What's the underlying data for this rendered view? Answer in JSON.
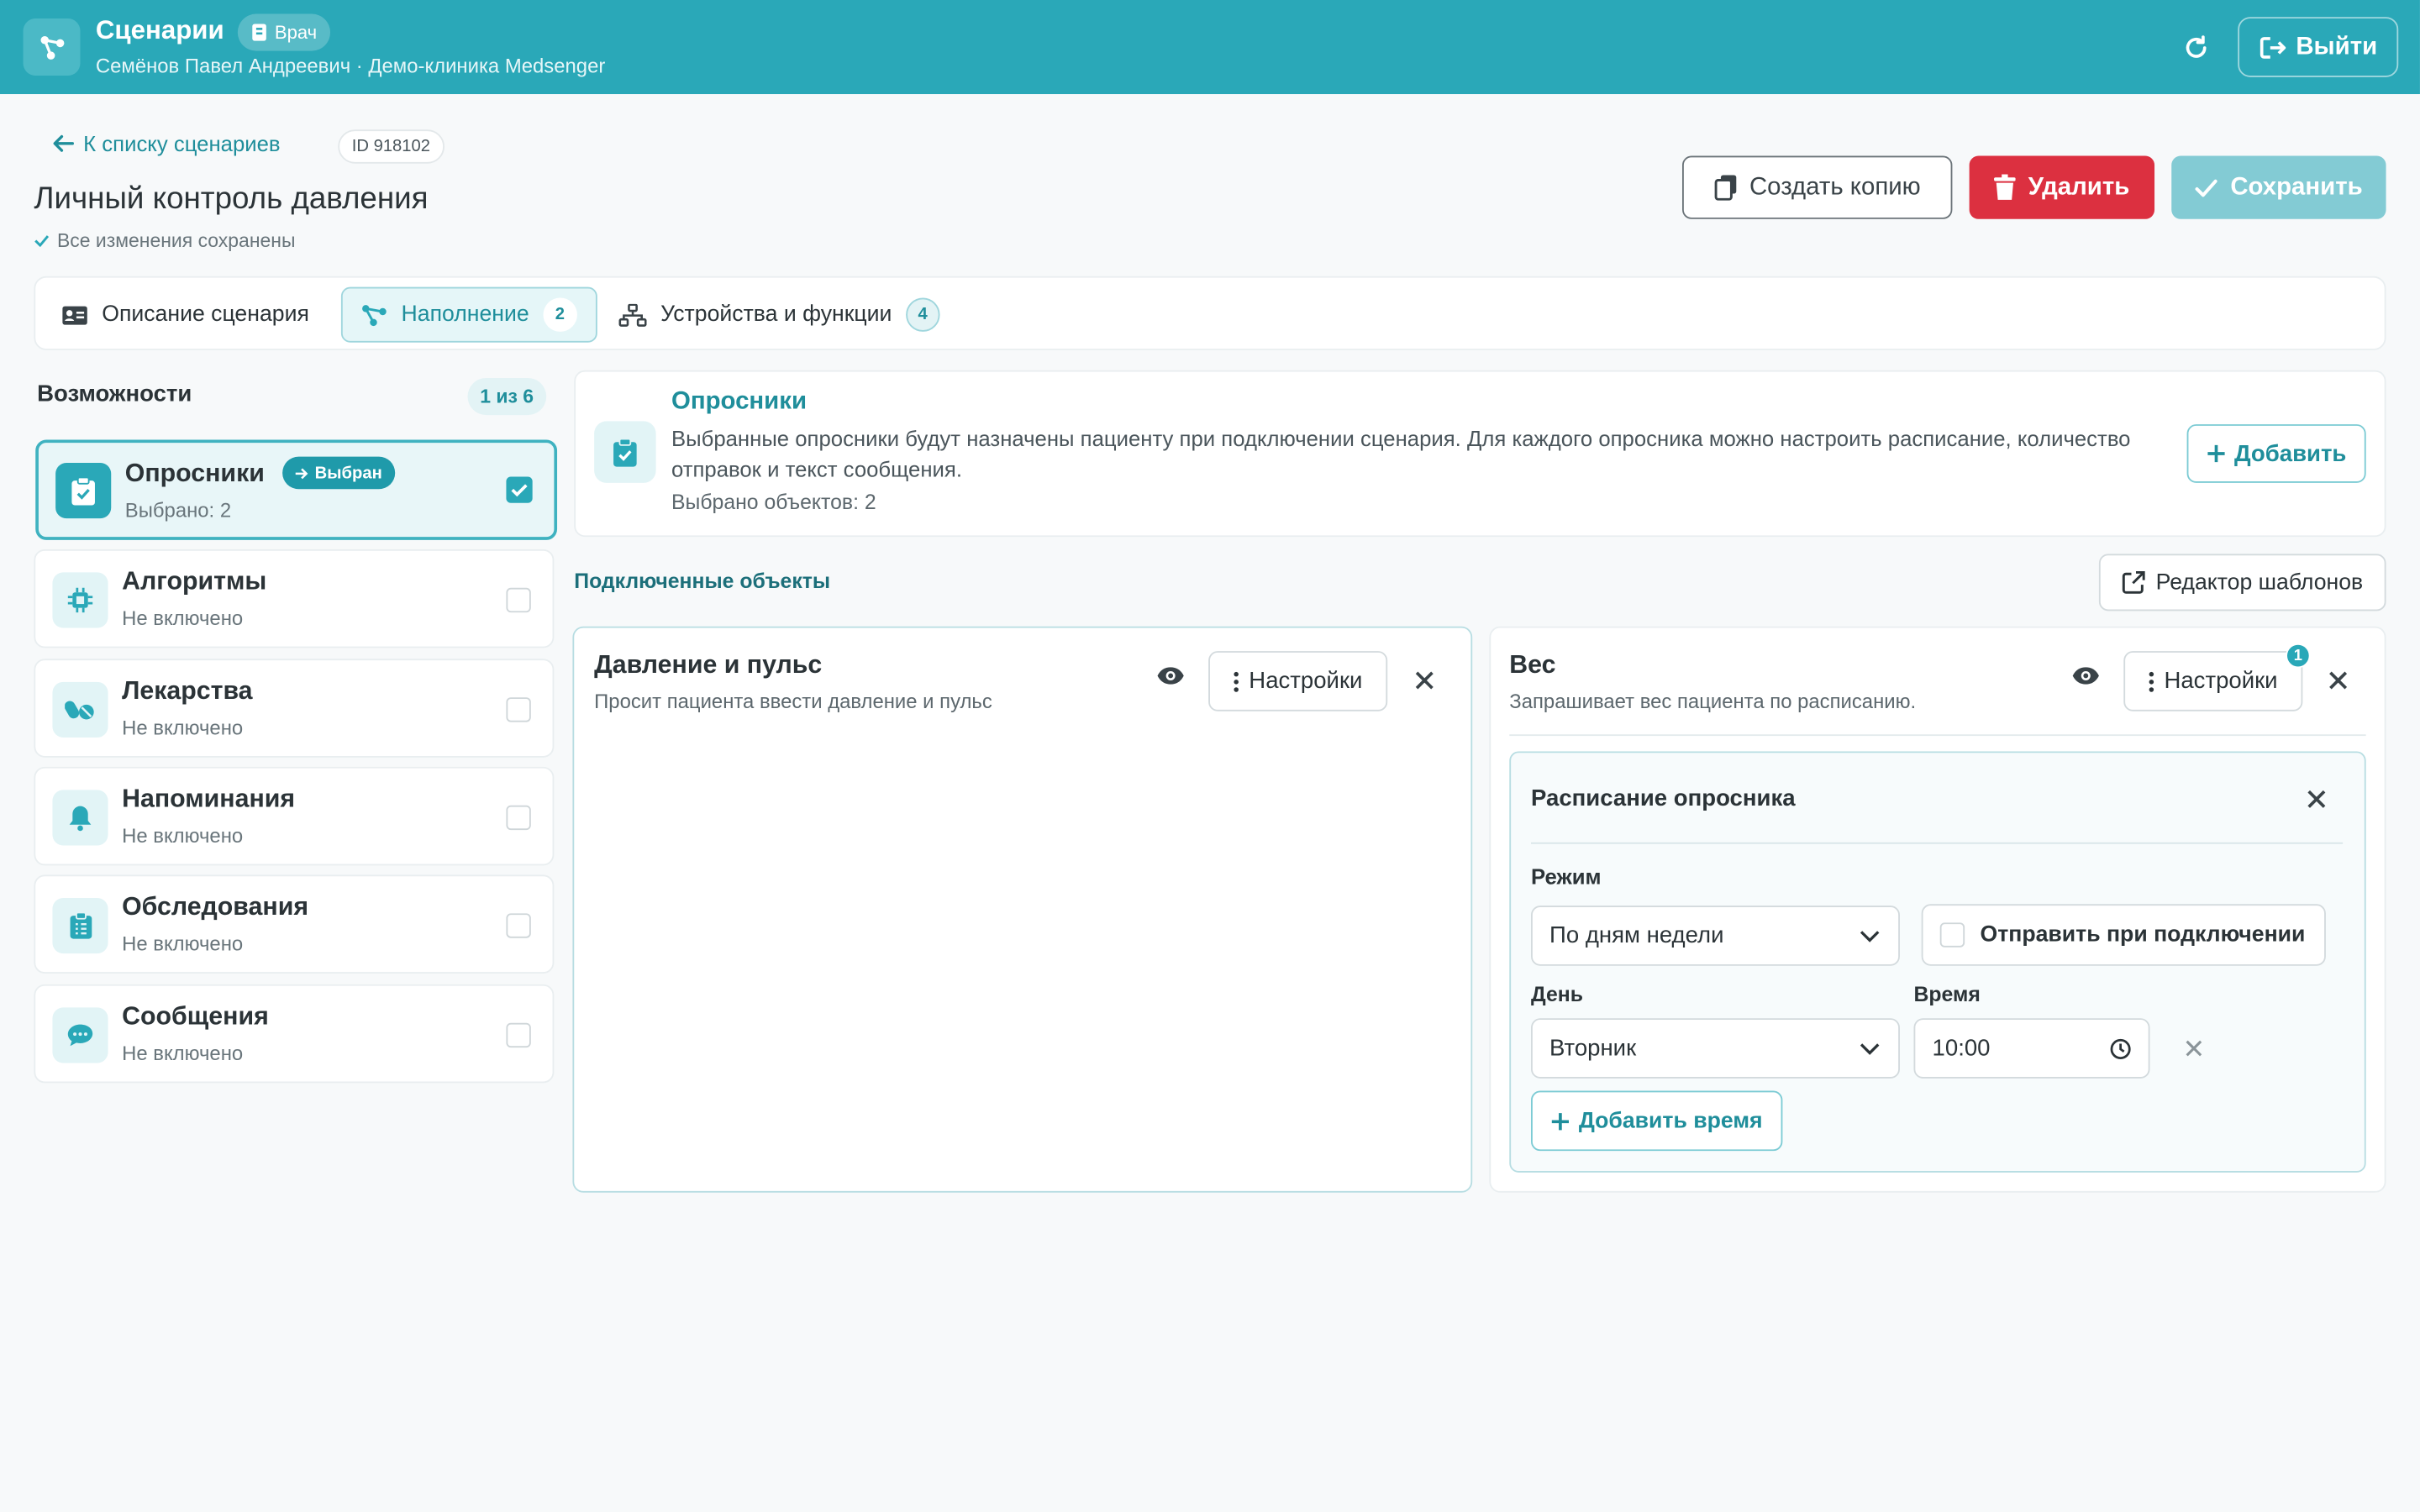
{
  "header": {
    "title": "Сценарии",
    "role": "Врач",
    "subtitle": "Семёнов Павел Андреевич · Демо-клиника Medsenger",
    "logout": "Выйти"
  },
  "page": {
    "back": "К списку сценариев",
    "id": "ID 918102",
    "title": "Личный контроль давления",
    "saved": "Все изменения сохранены",
    "actions": {
      "copy": "Создать копию",
      "delete": "Удалить",
      "save": "Сохранить"
    }
  },
  "tabs": [
    {
      "label": "Описание сценария",
      "count": ""
    },
    {
      "label": "Наполнение",
      "count": "2"
    },
    {
      "label": "Устройства и функции",
      "count": "4"
    }
  ],
  "capabilities": {
    "title": "Возможности",
    "counter": "1 из 6",
    "selected_badge": "Выбран",
    "items": [
      {
        "name": "Опросники",
        "status": "Выбрано: 2",
        "selected": true,
        "icon": "clipboard-check-icon"
      },
      {
        "name": "Алгоритмы",
        "status": "Не включено",
        "selected": false,
        "icon": "chip-icon"
      },
      {
        "name": "Лекарства",
        "status": "Не включено",
        "selected": false,
        "icon": "pills-icon"
      },
      {
        "name": "Напоминания",
        "status": "Не включено",
        "selected": false,
        "icon": "bell-icon"
      },
      {
        "name": "Обследования",
        "status": "Не включено",
        "selected": false,
        "icon": "clipboard-list-icon"
      },
      {
        "name": "Сообщения",
        "status": "Не включено",
        "selected": false,
        "icon": "chat-icon"
      }
    ]
  },
  "info": {
    "title": "Опросники",
    "description": "Выбранные опросники будут назначены пациенту при подключении сценария. Для каждого опросника можно настроить расписание, количество отправок и текст сообщения.",
    "count": "Выбрано объектов: 2",
    "add": "Добавить"
  },
  "connected": {
    "title": "Подключенные объекты",
    "editor": "Редактор шаблонов",
    "cards": [
      {
        "title": "Давление и пульс",
        "desc": "Просит пациента ввести давление и пульс",
        "settings": "Настройки"
      },
      {
        "title": "Вес",
        "desc": "Запрашивает вес пациента по расписанию.",
        "settings": "Настройки",
        "badge": "1"
      }
    ]
  },
  "schedule": {
    "title": "Расписание опросника",
    "mode_label": "Режим",
    "mode_value": "По дням недели",
    "send_on_connect": "Отправить при подключении",
    "day_label": "День",
    "day_value": "Вторник",
    "time_label": "Время",
    "time_value": "10:00",
    "add_time": "Добавить время"
  },
  "colors": {
    "brand": "#2aa8b8",
    "danger": "#dc3040",
    "save_disabled": "#83cbd4"
  }
}
